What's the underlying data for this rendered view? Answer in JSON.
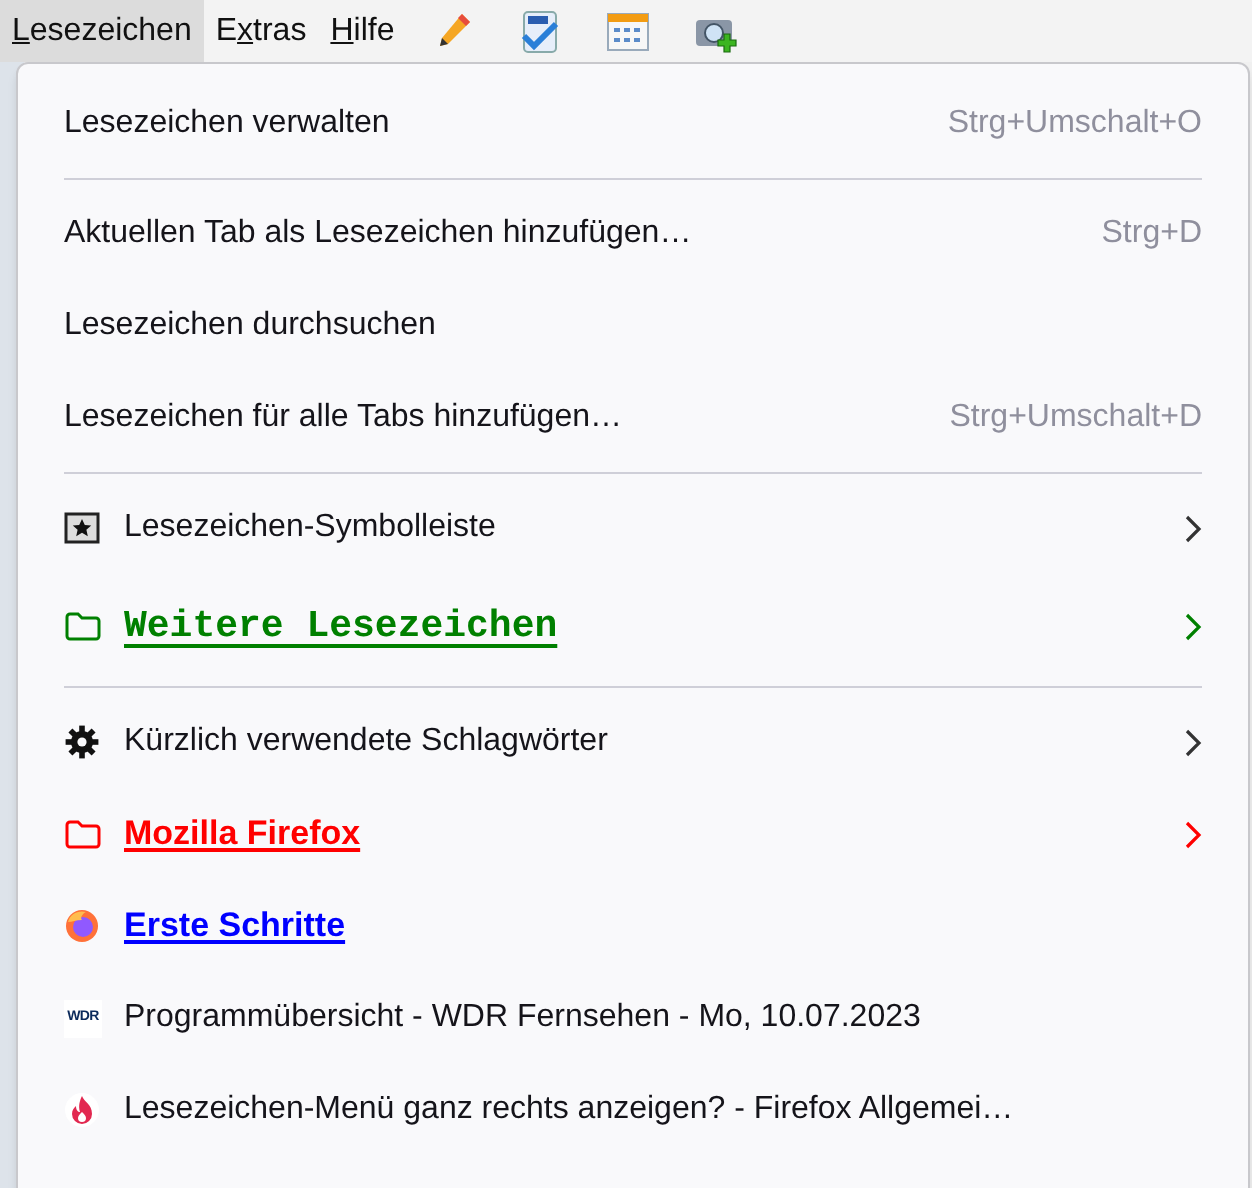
{
  "menubar": [
    {
      "key": "L",
      "after": "esezeichen",
      "selected": true
    },
    {
      "before": "E",
      "key": "x",
      "after": "tras",
      "selected": false
    },
    {
      "key": "H",
      "after": "ilfe",
      "selected": false
    }
  ],
  "menu": {
    "groups": [
      [
        {
          "kind": "action",
          "label": "Lesezeichen verwalten",
          "shortcut": "Strg+Umschalt+O"
        }
      ],
      [
        {
          "kind": "action",
          "label": "Aktuellen Tab als Lesezeichen hinzufügen…",
          "shortcut": "Strg+D"
        },
        {
          "kind": "action",
          "label": "Lesezeichen durchsuchen"
        },
        {
          "kind": "action",
          "label": "Lesezeichen für alle Tabs hinzufügen…",
          "shortcut": "Strg+Umschalt+D"
        }
      ],
      [
        {
          "kind": "toolbar-folder",
          "label": "Lesezeichen-Symbolleiste",
          "submenu": true
        },
        {
          "kind": "monofolder",
          "label": "Weitere Lesezeichen",
          "submenu": true,
          "link": true,
          "color": "#008000"
        }
      ],
      [
        {
          "kind": "tags",
          "label": "Kürzlich verwendete Schlagwörter",
          "submenu": true
        },
        {
          "kind": "folder",
          "label": "Mozilla Firefox",
          "submenu": true,
          "link": true,
          "color": "#ff0000"
        },
        {
          "kind": "firefox-page",
          "label": "Erste Schritte",
          "link": true,
          "color": "#0000ff"
        },
        {
          "kind": "wdr-page",
          "label": "Programmübersicht - WDR Fernsehen - Mo, 10.07.2023",
          "icon_text": "WDR"
        },
        {
          "kind": "flame-page",
          "label": "Lesezeichen-Menü ganz rechts anzeigen? - Firefox Allgemei…"
        }
      ]
    ]
  }
}
